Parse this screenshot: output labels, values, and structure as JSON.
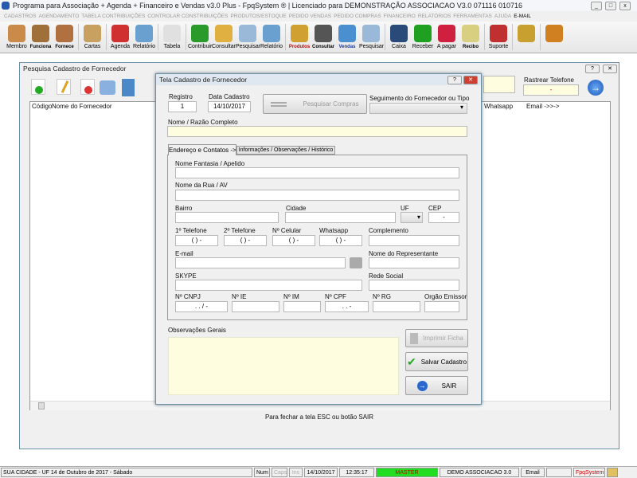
{
  "app": {
    "title": "Programa para Associação + Agenda + Financeiro e Vendas v3.0 Plus - FpqSystem ® | Licenciado para  DEMONSTRAÇÃO ASSOCIACAO V3.0 071116 010716"
  },
  "menu": [
    "CADASTROS",
    "AGENDAMENTO",
    "TABELA CONTRIBUIÇÕES",
    "CONTROLAR CONSTRIBUIÇÕES",
    "PRODUTOS/ESTOQUE",
    "PEDIDO VENDAS",
    "PEDIDO COMPRAS",
    "FINANCEIRO",
    "RELATÓRIOS",
    "FERRAMENTAS",
    "AJUDA"
  ],
  "menu_email": "E-MAIL",
  "toolbar": [
    {
      "label": "Membro",
      "icon": "members-icon",
      "color": "#c98a4a"
    },
    {
      "label": "Funciona",
      "icon": "employee-icon",
      "color": "#a0703a",
      "bold": true
    },
    {
      "label": "Fornece",
      "icon": "supplier-icon",
      "color": "#b07040",
      "bold": true
    },
    "|",
    {
      "label": "Cartas",
      "icon": "scroll-icon",
      "color": "#c8a060"
    },
    "|",
    {
      "label": "Agenda",
      "icon": "calendar-icon",
      "color": "#d03030"
    },
    {
      "label": "Relatório",
      "icon": "report-icon",
      "color": "#6aa0d0"
    },
    "|",
    {
      "label": "Tabela",
      "icon": "table-icon",
      "color": "#e0e0e0"
    },
    "|",
    {
      "label": "Contribuir",
      "icon": "dollar-icon",
      "color": "#2a9a2a"
    },
    {
      "label": "Consultar",
      "icon": "folder-icon",
      "color": "#e0b040"
    },
    {
      "label": "Pesquisar",
      "icon": "search-doc-icon",
      "color": "#9ab8d8"
    },
    {
      "label": "Relatório",
      "icon": "report-icon",
      "color": "#6aa0d0"
    },
    "|",
    {
      "label": "Produtos",
      "icon": "boxes-icon",
      "color": "#d0a030",
      "bold": true,
      "red": true
    },
    {
      "label": "Consultar",
      "icon": "barcode-icon",
      "color": "#555",
      "bold": true
    },
    {
      "label": "Vendas",
      "icon": "monitor-icon",
      "color": "#4a90d0",
      "bold": true,
      "blue": true
    },
    {
      "label": "Pesquisar",
      "icon": "search-doc-icon",
      "color": "#9ab8d8"
    },
    "|",
    {
      "label": "Caixa",
      "icon": "cashbook-icon",
      "color": "#2a4a7a"
    },
    {
      "label": "Receber",
      "icon": "receive-icon",
      "color": "#20a020"
    },
    {
      "label": "A pagar",
      "icon": "pay-icon",
      "color": "#d02040"
    },
    {
      "label": "Recibo",
      "icon": "receipt-icon",
      "color": "#d8d080",
      "bold": true
    },
    "|",
    {
      "label": "Suporte",
      "icon": "support-icon",
      "color": "#c03030"
    },
    "|",
    {
      "label": "",
      "icon": "coins-icon",
      "color": "#c8a030"
    },
    "|",
    {
      "label": "",
      "icon": "exit-door-icon",
      "color": "#d08020"
    }
  ],
  "search_window": {
    "title": "Pesquisa Cadastro de Fornecedor",
    "columns": [
      "Código",
      "Nome do Fornecedor"
    ],
    "right_columns": [
      "Whatsapp",
      "Email ->>->"
    ],
    "rastrear_label": "Rastrear Telefone",
    "rastrear_value": "-",
    "footer": "Para fechar a tela ESC ou botão SAIR",
    "help": "?",
    "close": "✕"
  },
  "dialog": {
    "title": "Tela Cadastro de Fornecedor",
    "help": "?",
    "close": "✕",
    "registro_label": "Registro",
    "registro": "1",
    "data_label": "Data Cadastro",
    "data": "14/10/2017",
    "pesquisar_compras": "Pesquisar Compras",
    "seguimento_label": "Seguimento do Fornecedor ou Tipo",
    "seguimento": "",
    "nome_label": "Nome / Razão Completo",
    "nome": "",
    "tabs": [
      "Endereço e Contatos  ->",
      "Informações / Observações / Histórico"
    ],
    "fields": {
      "fantasia": "Nome Fantasia / Apelido",
      "rua": "Nome da Rua / AV",
      "bairro": "Bairro",
      "cidade": "Cidade",
      "uf": "UF",
      "cep": "CEP",
      "cep_mask": "-",
      "tel1": "1º Telefone",
      "tel2": "2º Telefone",
      "cel": "Nº Celular",
      "whats": "Whatsapp",
      "phone_mask": "(  )    -",
      "complemento": "Complemento",
      "email": "E-mail",
      "representante": "Nome do Representante",
      "skype": "SKYPE",
      "rede": "Rede Social",
      "cnpj": "Nº CNPJ",
      "cnpj_mask": ".   .   /    -",
      "ie": "Nº IE",
      "im": "Nº IM",
      "cpf": "Nº CPF",
      "cpf_mask": ".   .   -",
      "rg": "Nº RG",
      "orgao": "Orgão Emissor"
    },
    "obs_label": "Observações Gerais",
    "imprimir": "Imprimir Ficha",
    "salvar": "Salvar Cadastro",
    "sair": "SAIR"
  },
  "status": {
    "city": "SUA CIDADE - UF 14 de Outubro de 2017 - Sábado",
    "num": "Num",
    "caps": "Caps",
    "ins": "Ins",
    "date": "14/10/2017",
    "time": "12:35:17",
    "user": "MASTER",
    "company": "DEMO ASSOCIACAO 3.0",
    "email": "Email",
    "brand": "FpqSystem"
  }
}
